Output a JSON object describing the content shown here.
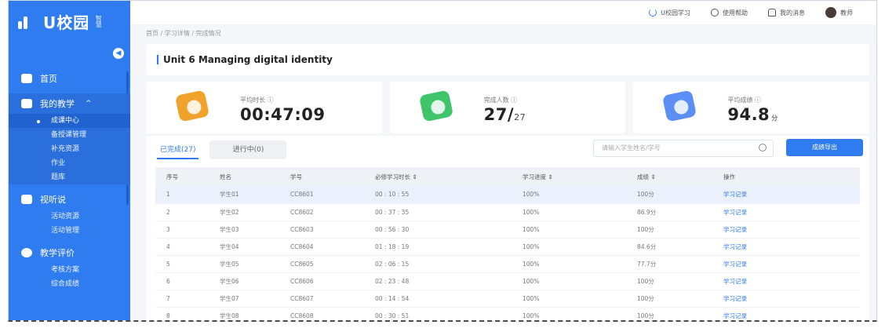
{
  "brand": {
    "name": "U校园",
    "sub": "智慧"
  },
  "sidebar": {
    "collapse_glyph": "◀",
    "items": [
      {
        "label": "首页",
        "icon": "home-icon"
      },
      {
        "label": "我的教学",
        "icon": "book-icon",
        "caret": "^",
        "children": [
          "成课中心",
          "备授课管理",
          "补充资源",
          "作业",
          "题库"
        ],
        "active_child": 0
      },
      {
        "label": "视听说",
        "icon": "monitor-icon",
        "children": [
          "活动资源",
          "活动管理"
        ]
      },
      {
        "label": "教学评价",
        "icon": "star-icon",
        "children": [
          "考核方案",
          "综合成绩"
        ]
      }
    ]
  },
  "topbar": {
    "items": [
      {
        "label": "U校园学习",
        "icon": "u-icon"
      },
      {
        "label": "使用帮助",
        "icon": "help-icon"
      },
      {
        "label": "我的消息",
        "icon": "bell-icon"
      },
      {
        "label": "教师",
        "icon": "user-avatar"
      }
    ]
  },
  "breadcrumb": "首页 / 学习详情 / 完成情况",
  "title": "Unit 6 Managing digital identity",
  "stats": [
    {
      "label": "平均时长 ⓘ",
      "value": "00:47:09",
      "suffix": "",
      "unit": "",
      "color": "#f0a22a",
      "icon": "clock-icon"
    },
    {
      "label": "完成人数 ⓘ",
      "value": "27/",
      "suffix": "27",
      "unit": "",
      "color": "#3fc46a",
      "icon": "people-icon"
    },
    {
      "label": "平均成绩 ⓘ",
      "value": "94.8",
      "suffix": "",
      "unit": "分",
      "color": "#5b8ff5",
      "icon": "score-icon"
    }
  ],
  "tabs": [
    "已完成(27)",
    "进行中(0)"
  ],
  "search": {
    "placeholder": "请输入学生姓名/学号"
  },
  "export_label": "成绩导出",
  "table": {
    "headers": [
      "序号",
      "姓名",
      "学号",
      "必修学习时长 ⇕",
      "学习进度 ⇕",
      "成绩 ⇕",
      "操作"
    ],
    "rows": [
      [
        "1",
        "学生01",
        "CC8601",
        "00 : 10 : 55",
        "100%",
        "100分",
        "学习记录"
      ],
      [
        "2",
        "学生02",
        "CC8602",
        "00 : 37 : 35",
        "100%",
        "86.9分",
        "学习记录"
      ],
      [
        "3",
        "学生03",
        "CC8603",
        "00 : 56 : 30",
        "100%",
        "100分",
        "学习记录"
      ],
      [
        "4",
        "学生04",
        "CC8604",
        "01 : 18 : 19",
        "100%",
        "84.6分",
        "学习记录"
      ],
      [
        "5",
        "学生05",
        "CC8605",
        "02 : 06 : 15",
        "100%",
        "77.7分",
        "学习记录"
      ],
      [
        "6",
        "学生06",
        "CC8606",
        "02 : 23 : 48",
        "100%",
        "100分",
        "学习记录"
      ],
      [
        "7",
        "学生07",
        "CC8607",
        "00 : 14 : 54",
        "100%",
        "100分",
        "学习记录"
      ],
      [
        "8",
        "学生08",
        "CC8608",
        "00 : 30 : 51",
        "100%",
        "100分",
        "学习记录"
      ]
    ]
  }
}
